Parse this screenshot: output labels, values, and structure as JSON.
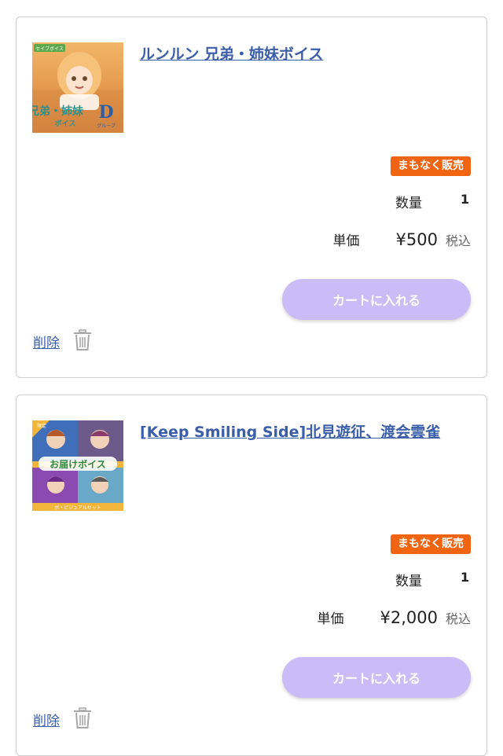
{
  "items": [
    {
      "title": "ルンルン 兄弟・姉妹ボイス",
      "thumb": {
        "tag": "セイブボイス",
        "line1": "兄弟・姉妹",
        "line2": "ボイス",
        "letter": "D",
        "group": "グループ"
      },
      "badge": "まもなく販売",
      "quantity_label": "数量",
      "quantity": "1",
      "price_label": "単価",
      "price": "¥500",
      "tax_label": "税込",
      "cart_button": "カートに入れる",
      "delete_label": "削除"
    },
    {
      "title": "[Keep Smiling Side]北見遊征、渡会雲雀",
      "thumb": {
        "tag": "限定",
        "caption": "お届けボイス",
        "footer": "ボ・ビジュアルセット"
      },
      "badge": "まもなく販売",
      "quantity_label": "数量",
      "quantity": "1",
      "price_label": "単価",
      "price": "¥2,000",
      "tax_label": "税込",
      "cart_button": "カートに入れる",
      "delete_label": "削除"
    }
  ],
  "colors": {
    "link": "#3a5ea8",
    "badge": "#f06412",
    "button": "#cbbcf8"
  }
}
